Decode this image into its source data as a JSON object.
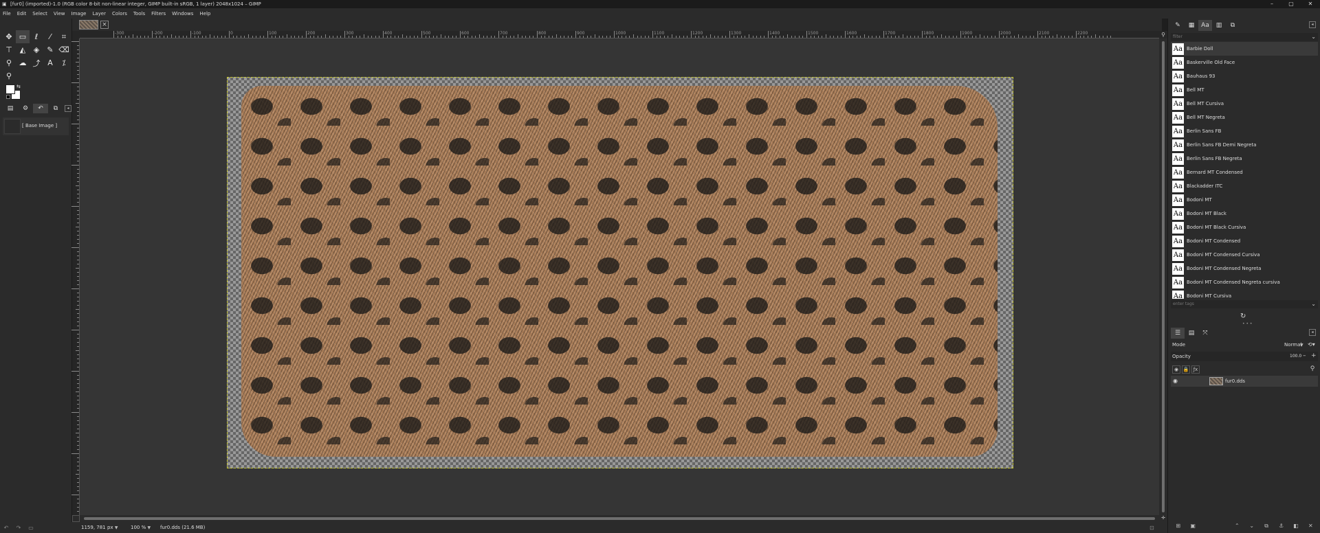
{
  "window": {
    "title": "[fur0] (imported)-1.0 (RGB color 8-bit non-linear integer, GIMP built-in sRGB, 1 layer) 2048x1024 – GIMP",
    "minimize": "–",
    "maximize": "▢",
    "close": "✕"
  },
  "menubar": [
    "File",
    "Edit",
    "Select",
    "View",
    "Image",
    "Layer",
    "Colors",
    "Tools",
    "Filters",
    "Windows",
    "Help"
  ],
  "tab": {
    "close_label": "×"
  },
  "toolbox": {
    "base_image_label": "[ Base Image ]",
    "foreground_color": "#ffffff",
    "background_color": "#ffffff"
  },
  "ruler": {
    "labels": [
      "-300",
      "-200",
      "-100",
      "0",
      "100",
      "200",
      "300",
      "400",
      "500",
      "600",
      "700",
      "800",
      "900",
      "1000",
      "1100",
      "1200",
      "1300",
      "1400",
      "1500",
      "1600",
      "1700",
      "1800",
      "1900",
      "2000",
      "2100",
      "2200"
    ]
  },
  "statusbar": {
    "coords": "1159, 781",
    "unit": "px",
    "zoom": "100 %",
    "file_info": "fur0.dds (21.6 MB)"
  },
  "fonts": {
    "filter_placeholder": "filter",
    "tags_placeholder": "enter tags",
    "items": [
      {
        "name": "Barbie Doll",
        "glyph": "Aa"
      },
      {
        "name": "Baskerville Old Face",
        "glyph": "Aa"
      },
      {
        "name": "Bauhaus 93",
        "glyph": "Aa"
      },
      {
        "name": "Bell MT",
        "glyph": "Aa"
      },
      {
        "name": "Bell MT Cursiva",
        "glyph": "Aa"
      },
      {
        "name": "Bell MT Negreta",
        "glyph": "Aa"
      },
      {
        "name": "Berlin Sans FB",
        "glyph": "Aa"
      },
      {
        "name": "Berlin Sans FB Demi Negreta",
        "glyph": "Aa"
      },
      {
        "name": "Berlin Sans FB Negreta",
        "glyph": "Aa"
      },
      {
        "name": "Bernard MT Condensed",
        "glyph": "Aa"
      },
      {
        "name": "Blackadder ITC",
        "glyph": "Aa"
      },
      {
        "name": "Bodoni MT",
        "glyph": "Aa"
      },
      {
        "name": "Bodoni MT Black",
        "glyph": "Aa"
      },
      {
        "name": "Bodoni MT Black Cursiva",
        "glyph": "Aa"
      },
      {
        "name": "Bodoni MT Condensed",
        "glyph": "Aa"
      },
      {
        "name": "Bodoni MT Condensed Cursiva",
        "glyph": "Aa"
      },
      {
        "name": "Bodoni MT Condensed Negreta",
        "glyph": "Aa"
      },
      {
        "name": "Bodoni MT Condensed Negreta cursiva",
        "glyph": "Aa"
      },
      {
        "name": "Bodoni MT Cursiva",
        "glyph": "Aa"
      }
    ]
  },
  "layers": {
    "mode_label": "Mode",
    "mode_value": "Normal",
    "opacity_label": "Opacity",
    "opacity_value": "100.0",
    "items": [
      {
        "name": "fur0.dds",
        "visible": true
      }
    ]
  },
  "colors": {
    "selection_border": "#c8c832",
    "fur_base": "#be8250"
  }
}
